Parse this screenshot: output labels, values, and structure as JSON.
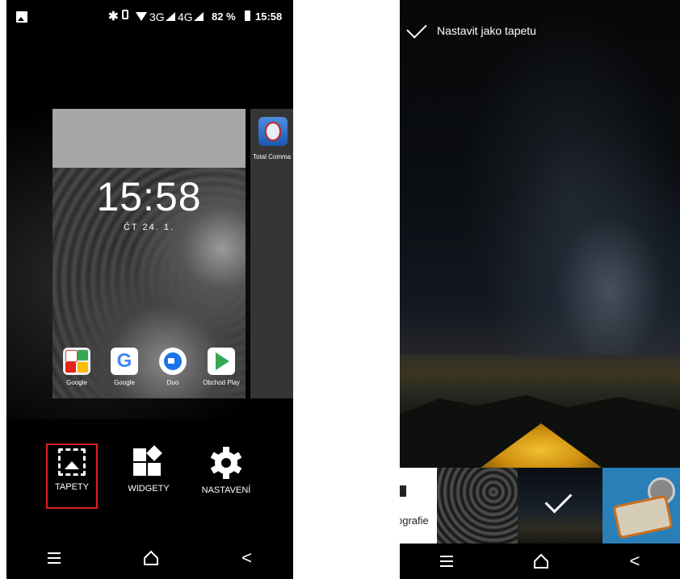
{
  "left_phone": {
    "status_bar": {
      "bluetooth_icon": "bluetooth-icon",
      "network_3g": "3G",
      "network_4g": "4G",
      "battery_percent": "82 %",
      "time": "15:58"
    },
    "preview": {
      "time": "15:58",
      "date": "ČT 24. 1.",
      "dock": [
        {
          "label": "Google",
          "icon": "google-folder-icon"
        },
        {
          "label": "Google",
          "icon": "google-g-icon"
        },
        {
          "label": "Duo",
          "icon": "duo-icon"
        },
        {
          "label": "Obchod Play",
          "icon": "play-store-icon"
        }
      ]
    },
    "side_preview": {
      "app_label": "Total Comma"
    },
    "options": [
      {
        "label": "TAPETY",
        "icon": "wallpaper-icon"
      },
      {
        "label": "WIDGETY",
        "icon": "widgets-icon"
      },
      {
        "label": "NASTAVENÍ",
        "icon": "settings-gear-icon"
      }
    ],
    "highlight_color": "#e0201f"
  },
  "right_phone": {
    "set_wallpaper_label": "Nastavit jako tapetu",
    "thumbnails": [
      {
        "label": "ografie"
      }
    ]
  }
}
